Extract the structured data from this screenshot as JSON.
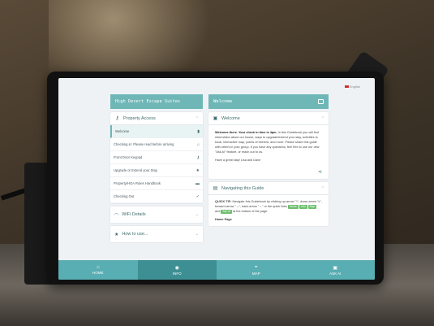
{
  "screen": {
    "language": "English"
  },
  "left": {
    "header_title": "High Desert Escape Suites",
    "property_access": {
      "title": "Property Access",
      "items": [
        {
          "label": "Welcome",
          "icon": "briefcase-icon",
          "glyph": "▮"
        },
        {
          "label": "Checking in: Please read before arriving",
          "icon": "home-icon",
          "glyph": "⌂"
        },
        {
          "label": "Front Door Keypad",
          "icon": "key-icon",
          "glyph": "⚷"
        },
        {
          "label": "Upgrade or Extend your Stay",
          "icon": "star-icon",
          "glyph": "★"
        },
        {
          "label": "Property/HOA Rules Handbook",
          "icon": "book-icon",
          "glyph": "▬"
        },
        {
          "label": "Checking Out",
          "icon": "check-icon",
          "glyph": "✓"
        }
      ]
    },
    "wifi": {
      "title": "WiFi Details"
    },
    "howto": {
      "title": "How to use..."
    }
  },
  "right": {
    "header_title": "Welcome",
    "welcome_card": {
      "title": "Welcome",
      "body_bold": "Welcome there. Your check in time is 4pm.",
      "body": " In this Guidebook you will find information about our house, ways to upgrade/extend your stay, activities to book, interactive map, points of interest, and more. Please share this guide with others in your group. If you have any questions, feel free to use our new \"Ask AI\" feature, or reach out to us.",
      "signoff": "Have a great stay! Lisa and Dave"
    },
    "nav_card": {
      "title": "Navigating this Guide",
      "tip_bold": "QUICK TIP:",
      "tip_text": " Navigate this Guidebook by clicking up-arrow \"^\", down-arrow \"v\", forward-arrow \"→\", back-arrow \"←\" or the quick links",
      "pills": [
        "Home",
        "Info",
        "Map",
        "Ask AI"
      ],
      "tip_end": "at the bottom of the page.",
      "home_page": "Home Page"
    }
  },
  "bottom_nav": [
    {
      "label": "HOME",
      "icon": "home-icon",
      "glyph": "⌂",
      "active": false
    },
    {
      "label": "INFO",
      "icon": "info-icon",
      "glyph": "◉",
      "active": true
    },
    {
      "label": "MAP",
      "icon": "map-icon",
      "glyph": "⌖",
      "active": false
    },
    {
      "label": "ASK AI",
      "icon": "chat-icon",
      "glyph": "▣",
      "active": false
    }
  ],
  "colors": {
    "accent": "#6fb7b7",
    "nav": "#58aeb2",
    "nav_active": "#3d8f93"
  }
}
